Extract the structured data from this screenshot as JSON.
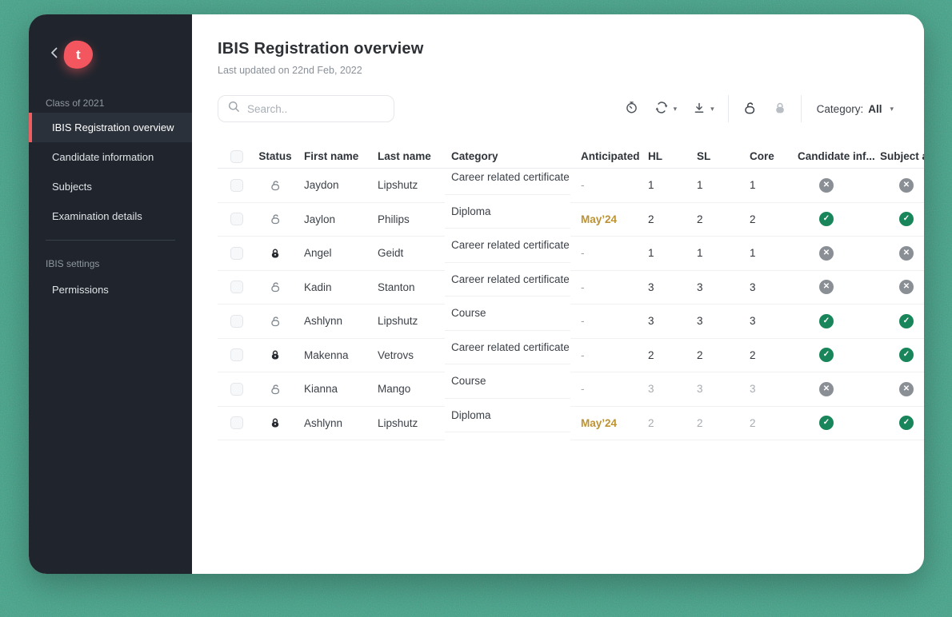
{
  "app": {
    "logo_letter": "t"
  },
  "sidebar": {
    "sections": [
      {
        "label": "Class of 2021",
        "items": [
          {
            "label": "IBIS Registration overview",
            "active": true
          },
          {
            "label": "Candidate information",
            "active": false
          },
          {
            "label": "Subjects",
            "active": false
          },
          {
            "label": "Examination details",
            "active": false
          }
        ]
      },
      {
        "label": "IBIS settings",
        "items": [
          {
            "label": "Permissions",
            "active": false
          }
        ]
      }
    ]
  },
  "header": {
    "title": "IBIS Registration overview",
    "updated": "Last updated on 22nd Feb, 2022"
  },
  "toolbar": {
    "search_placeholder": "Search..",
    "icons": [
      "timer-icon",
      "refresh-icon",
      "download-icon",
      "unlock-icon",
      "lock-icon"
    ],
    "category_filter": {
      "label": "Category:",
      "value": "All"
    }
  },
  "table": {
    "columns": [
      "",
      "Status",
      "First name",
      "Last name",
      "Category",
      "Anticipated",
      "HL",
      "SL",
      "Core",
      "Candidate inf...",
      "Subject approval"
    ],
    "rows": [
      {
        "status": "unlocked",
        "first": "Jaydon",
        "last": "Lipshutz",
        "category": "Career related certificate",
        "anticipated": "-",
        "hl": "1",
        "sl": "1",
        "core": "1",
        "candidate_info": "rejected",
        "subject_approval": "rejected",
        "numbers_dimmed": false
      },
      {
        "status": "unlocked",
        "first": "Jaylon",
        "last": "Philips",
        "category": "Diploma",
        "anticipated": "May’24",
        "hl": "2",
        "sl": "2",
        "core": "2",
        "candidate_info": "approved",
        "subject_approval": "approved",
        "numbers_dimmed": false
      },
      {
        "status": "locked",
        "first": "Angel",
        "last": "Geidt",
        "category": "Career related certificate",
        "anticipated": "-",
        "hl": "1",
        "sl": "1",
        "core": "1",
        "candidate_info": "rejected",
        "subject_approval": "rejected",
        "numbers_dimmed": false
      },
      {
        "status": "unlocked",
        "first": "Kadin",
        "last": "Stanton",
        "category": "Career related certificate",
        "anticipated": "-",
        "hl": "3",
        "sl": "3",
        "core": "3",
        "candidate_info": "rejected",
        "subject_approval": "rejected",
        "numbers_dimmed": false
      },
      {
        "status": "unlocked",
        "first": "Ashlynn",
        "last": "Lipshutz",
        "category": "Course",
        "anticipated": "-",
        "hl": "3",
        "sl": "3",
        "core": "3",
        "candidate_info": "approved",
        "subject_approval": "approved",
        "numbers_dimmed": false
      },
      {
        "status": "locked",
        "first": "Makenna",
        "last": "Vetrovs",
        "category": "Career related certificate",
        "anticipated": "-",
        "hl": "2",
        "sl": "2",
        "core": "2",
        "candidate_info": "approved",
        "subject_approval": "approved",
        "numbers_dimmed": false
      },
      {
        "status": "unlocked",
        "first": "Kianna",
        "last": "Mango",
        "category": "Course",
        "anticipated": "-",
        "hl": "3",
        "sl": "3",
        "core": "3",
        "candidate_info": "rejected",
        "subject_approval": "rejected",
        "numbers_dimmed": true
      },
      {
        "status": "locked",
        "first": "Ashlynn",
        "last": "Lipshutz",
        "category": "Diploma",
        "anticipated": "May’24",
        "hl": "2",
        "sl": "2",
        "core": "2",
        "candidate_info": "approved",
        "subject_approval": "approved",
        "numbers_dimmed": true
      }
    ]
  },
  "colors": {
    "canvas_green": "#3FA287",
    "sidebar_bg": "#20252D",
    "active_item_bg": "#2B313A",
    "accent_red": "#EF5D60",
    "logo_pink": "#F3565E",
    "gold": "#BC9232",
    "badge_green": "#19855A",
    "badge_gray": "#8A8F95"
  }
}
